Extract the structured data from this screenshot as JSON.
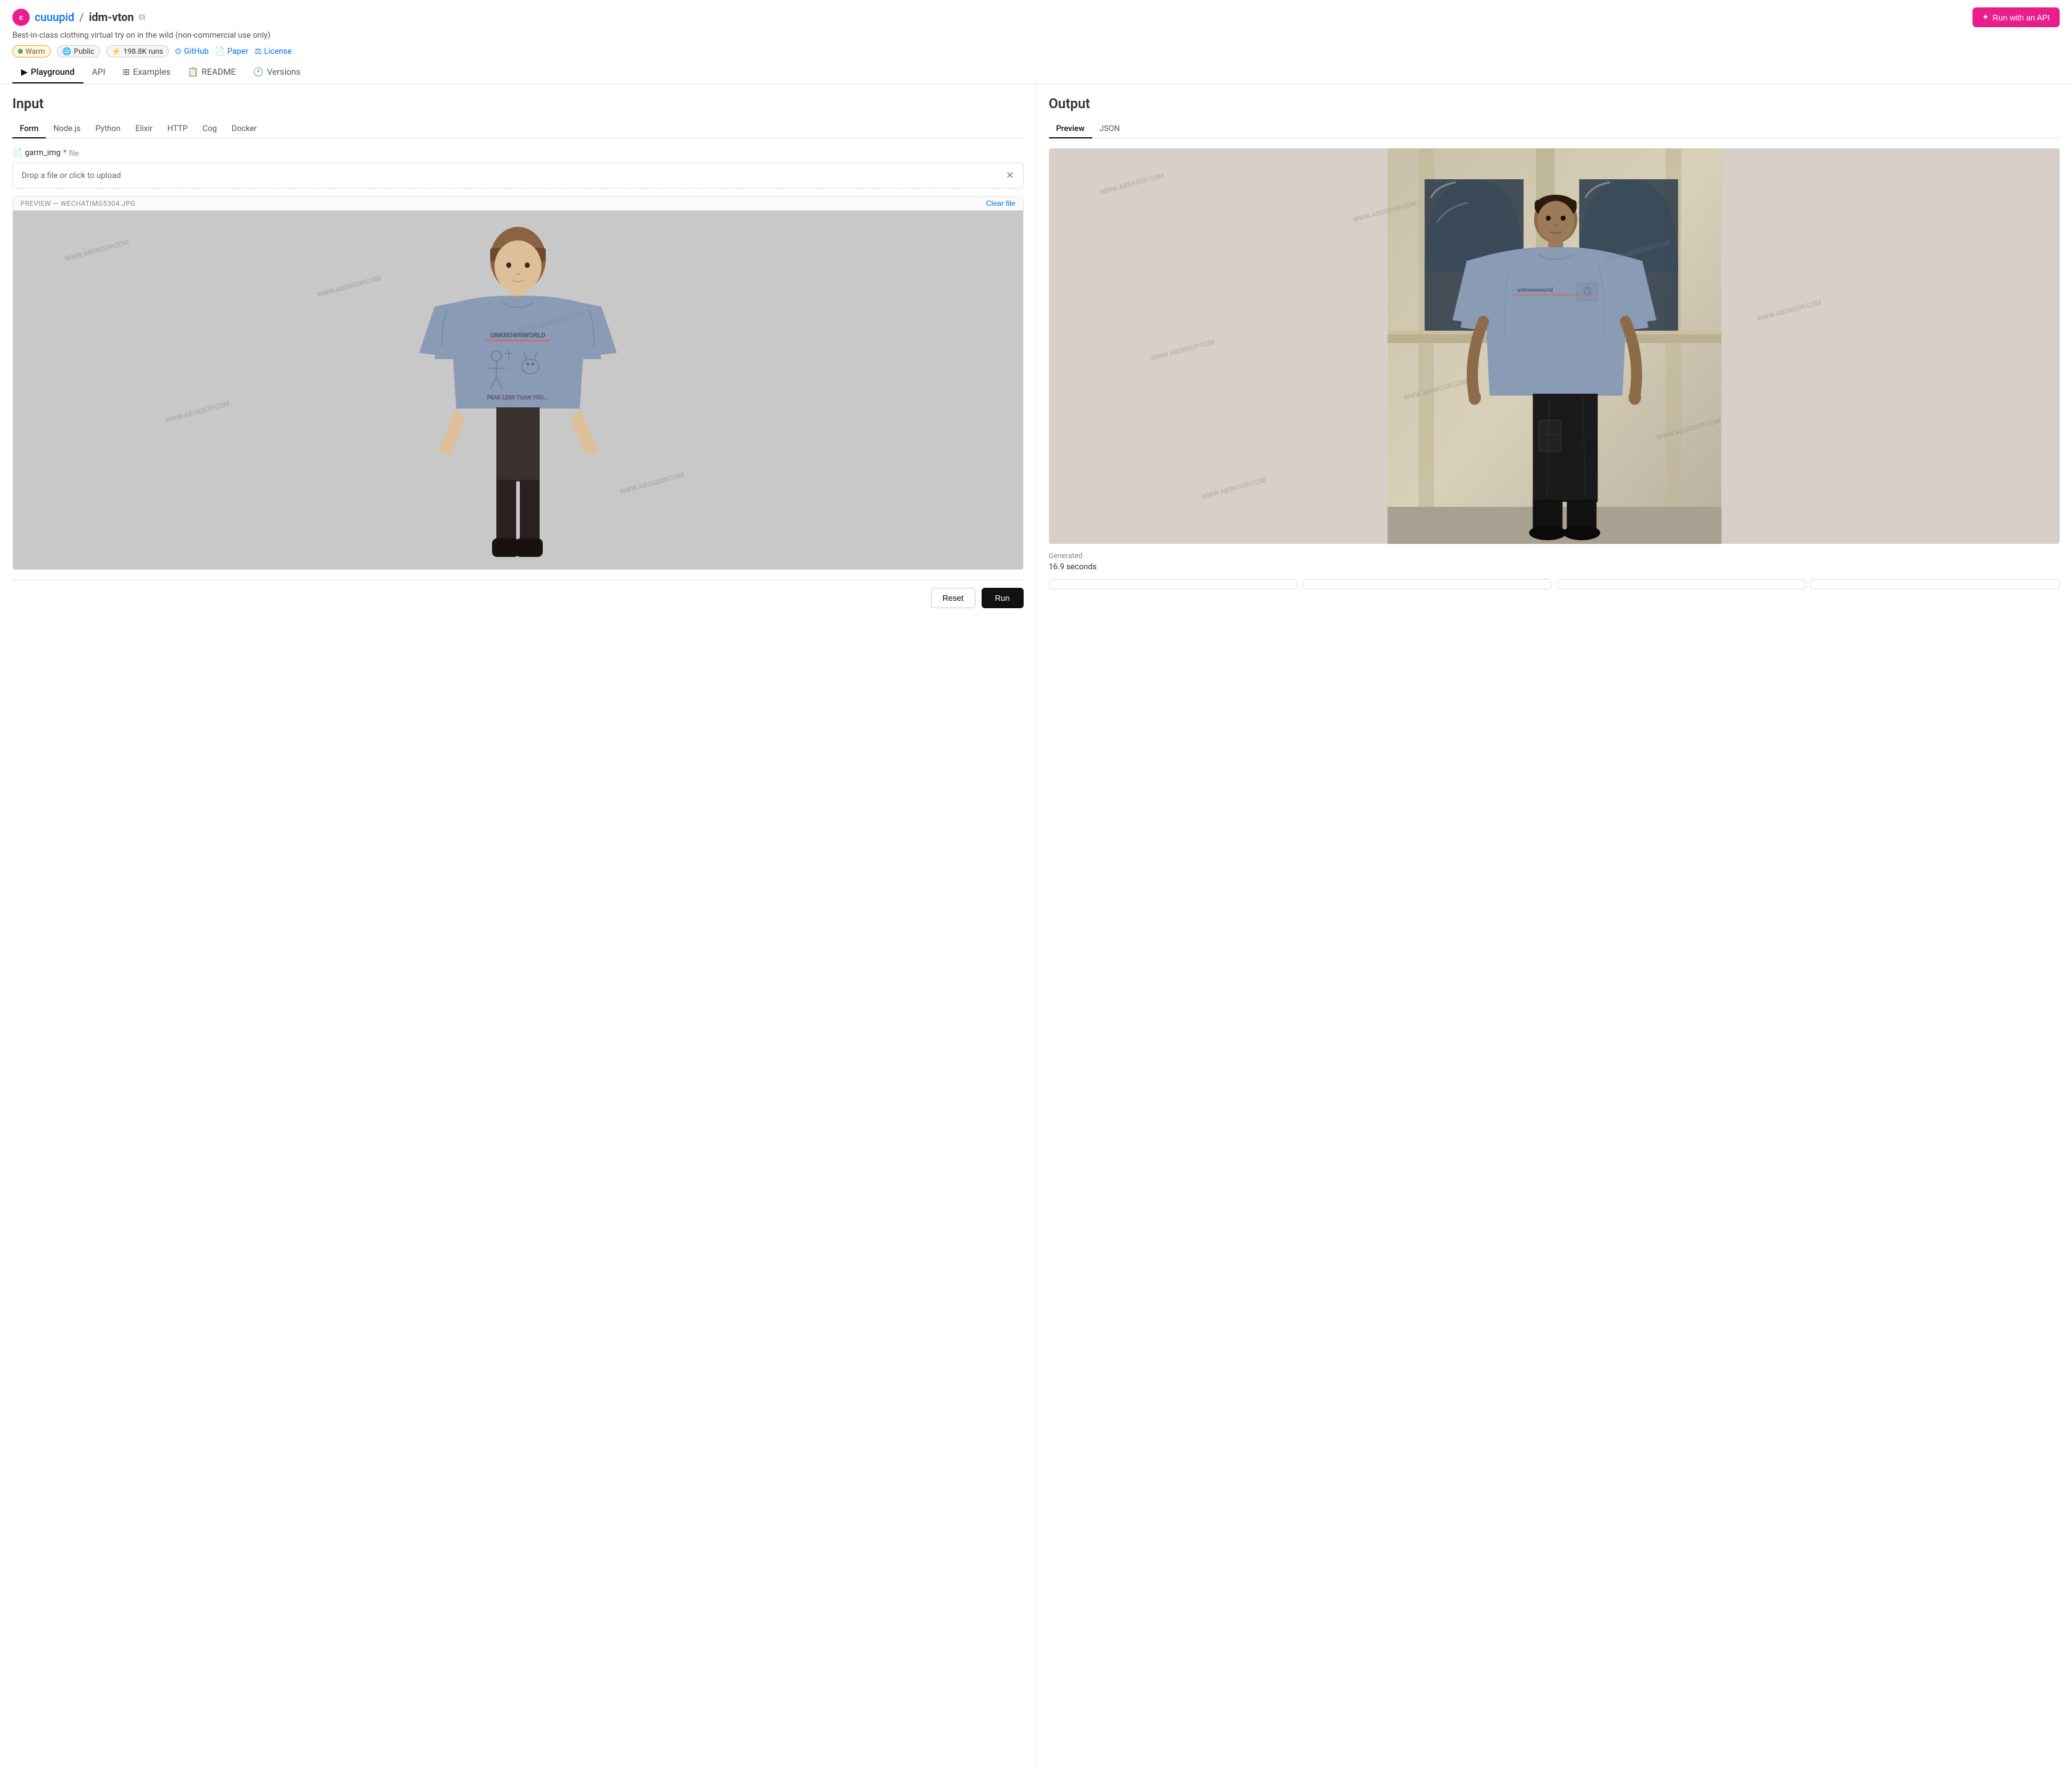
{
  "header": {
    "owner": "cuuupid",
    "repo": "idm-vton",
    "description": "Best-in-class clothing virtual try on in the wild (non-commercial use only)",
    "badges": {
      "warm": "Warm",
      "public": "Public",
      "runs": "198.8K runs"
    },
    "links": {
      "github": "GitHub",
      "paper": "Paper",
      "license": "License"
    },
    "run_api_label": "Run with an API"
  },
  "nav": {
    "tabs": [
      {
        "label": "Playground",
        "active": true
      },
      {
        "label": "API",
        "active": false
      },
      {
        "label": "Examples",
        "active": false
      },
      {
        "label": "README",
        "active": false
      },
      {
        "label": "Versions",
        "active": false
      }
    ]
  },
  "input": {
    "title": "Input",
    "sub_tabs": [
      "Form",
      "Node.js",
      "Python",
      "Elixir",
      "HTTP",
      "Cog",
      "Docker"
    ],
    "active_sub_tab": "Form",
    "field_label": "garm_img",
    "field_type": "file",
    "upload_placeholder": "Drop a file or click to upload",
    "preview_label": "PREVIEW — WECHATIMG5304.JPG",
    "clear_file": "Clear file"
  },
  "output": {
    "title": "Output",
    "sub_tabs": [
      "Preview",
      "JSON"
    ],
    "active_sub_tab": "Preview",
    "generated_label": "Generated",
    "time_label": "16.9 seconds"
  },
  "actions": {
    "reset": "Reset",
    "run": "Run"
  },
  "bottom_buttons": [
    "",
    "",
    "",
    ""
  ],
  "watermark": "WWW.ABSKOOP.COM"
}
